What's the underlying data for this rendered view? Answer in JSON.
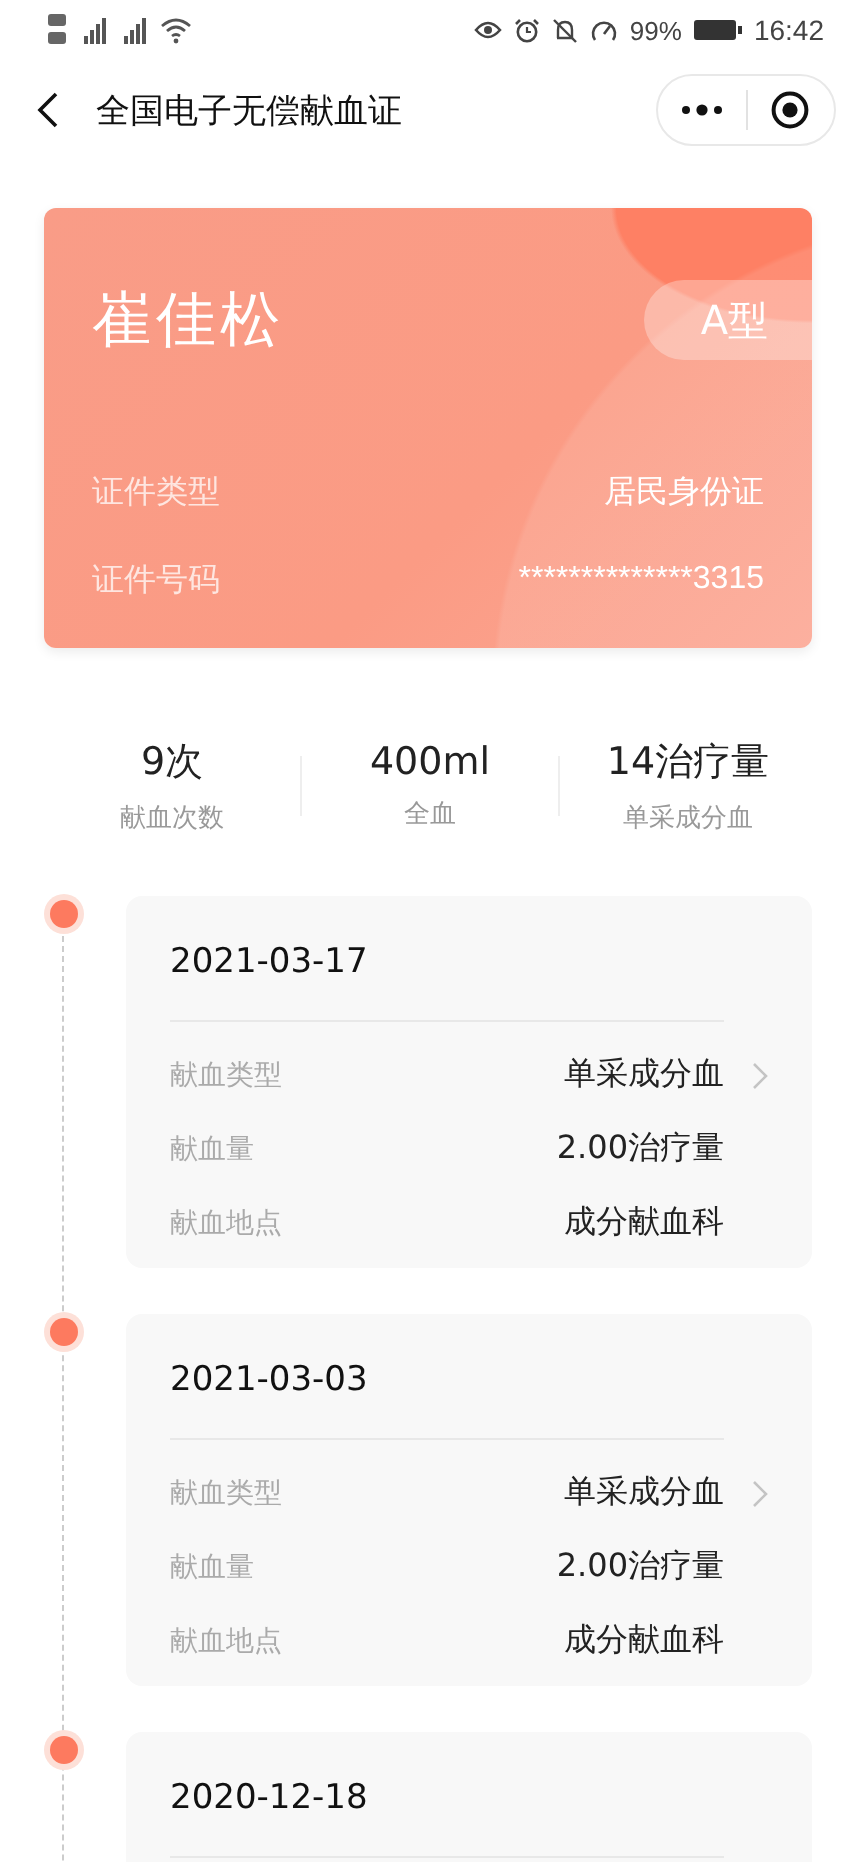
{
  "status_bar": {
    "battery": "99%",
    "time": "16:42"
  },
  "nav_bar": {
    "title": "全国电子无偿献血证"
  },
  "donor_card": {
    "name": "崔佳松",
    "blood_type": "A型",
    "fields": [
      {
        "label": "证件类型",
        "value": "居民身份证"
      },
      {
        "label": "证件号码",
        "value": "**************3315"
      }
    ]
  },
  "stats": [
    {
      "value": "9次",
      "label": "献血次数"
    },
    {
      "value": "400ml",
      "label": "全血"
    },
    {
      "value": "14治疗量",
      "label": "单采成分血"
    }
  ],
  "records": [
    {
      "date": "2021-03-17",
      "rows": [
        {
          "label": "献血类型",
          "value": "单采成分血",
          "chevron": true
        },
        {
          "label": "献血量",
          "value": "2.00治疗量",
          "chevron": false
        },
        {
          "label": "献血地点",
          "value": "成分献血科",
          "chevron": false
        }
      ]
    },
    {
      "date": "2021-03-03",
      "rows": [
        {
          "label": "献血类型",
          "value": "单采成分血",
          "chevron": true
        },
        {
          "label": "献血量",
          "value": "2.00治疗量",
          "chevron": false
        },
        {
          "label": "献血地点",
          "value": "成分献血科",
          "chevron": false
        }
      ]
    },
    {
      "date": "2020-12-18"
    }
  ]
}
